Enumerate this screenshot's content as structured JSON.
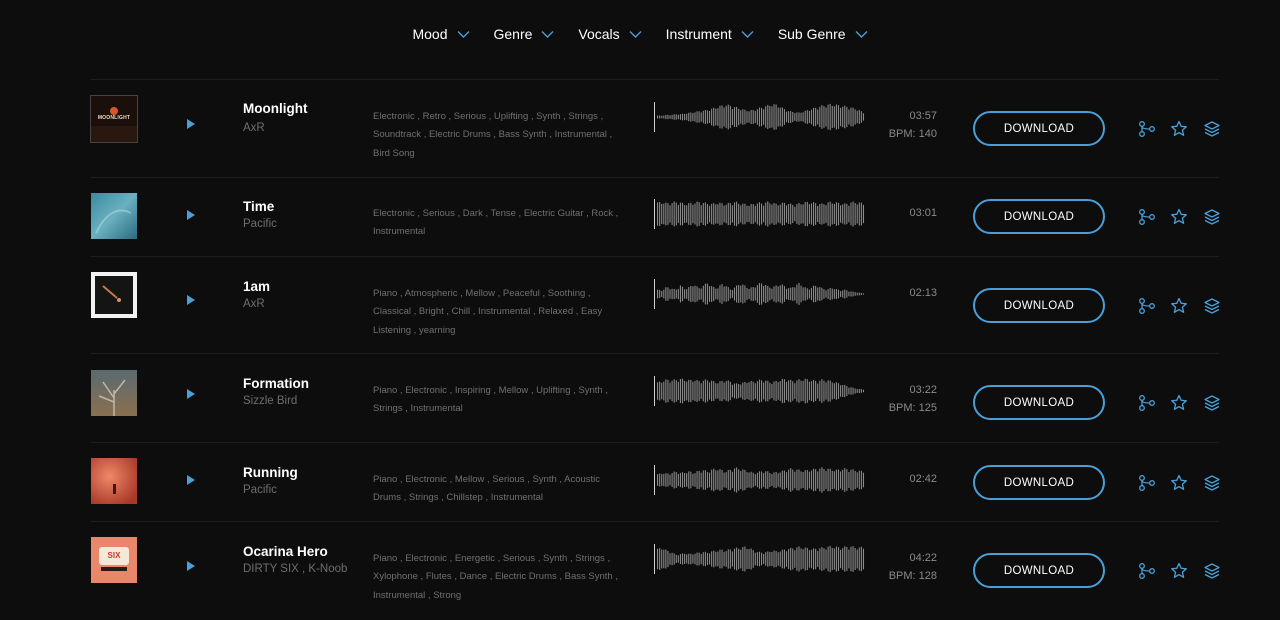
{
  "filters": [
    {
      "label": "Mood"
    },
    {
      "label": "Genre"
    },
    {
      "label": "Vocals"
    },
    {
      "label": "Instrument"
    },
    {
      "label": "Sub Genre"
    }
  ],
  "download_label": "DOWNLOAD",
  "accent": "#4a9fd8",
  "tracks": [
    {
      "title": "Moonlight",
      "artist": "AxR",
      "tags": "Electronic , Retro , Serious , Uplifting , Synth , Strings , Soundtrack , Electric Drums , Bass Synth , Instrumental , Bird Song",
      "duration": "03:57",
      "bpm": "BPM: 140",
      "cover_text": "MOONLIGHT"
    },
    {
      "title": "Time",
      "artist": "Pacific",
      "tags": "Electronic , Serious , Dark , Tense , Electric Guitar , Rock , Instrumental",
      "duration": "03:01",
      "bpm": ""
    },
    {
      "title": "1am",
      "artist": "AxR",
      "tags": "Piano , Atmospheric , Mellow , Peaceful , Soothing , Classical , Bright , Chill , Instrumental , Relaxed , Easy Listening , yearning",
      "duration": "02:13",
      "bpm": ""
    },
    {
      "title": "Formation",
      "artist": "Sizzle Bird",
      "tags": "Piano , Electronic , Inspiring , Mellow , Uplifting , Synth , Strings , Instrumental",
      "duration": "03:22",
      "bpm": "BPM: 125"
    },
    {
      "title": "Running",
      "artist": "Pacific",
      "tags": "Piano , Electronic , Mellow , Serious , Synth , Acoustic Drums , Strings , Chillstep , Instrumental",
      "duration": "02:42",
      "bpm": ""
    },
    {
      "title": "Ocarina Hero",
      "artist": "DIRTY SIX , K-Noob",
      "tags": "Piano , Electronic , Energetic , Serious , Synth , Strings , Xylophone , Flutes , Dance , Electric Drums , Bass Synth , Instrumental , Strong",
      "duration": "04:22",
      "bpm": "BPM: 128",
      "cover_text": "SIX"
    }
  ],
  "icons": [
    "chevron-down-icon",
    "play-icon",
    "stems-icon",
    "star-icon",
    "layers-icon"
  ]
}
